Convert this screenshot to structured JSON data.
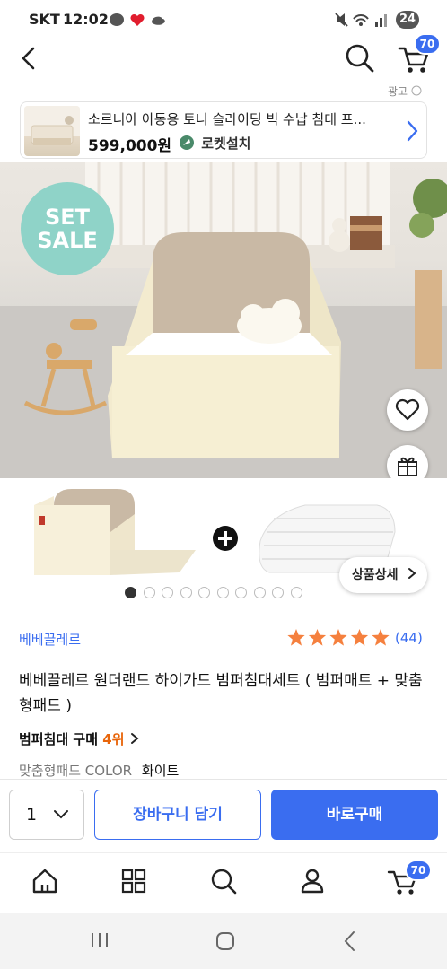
{
  "status_bar": {
    "carrier": "SKT",
    "time": "12:02",
    "battery": "24"
  },
  "header": {
    "cart_count": "70"
  },
  "ad": {
    "label": "광고",
    "title": "소르니아 아동용 토니 슬라이딩 빅 수납 침대 프...",
    "price": "599,000원",
    "delivery": "로켓설치"
  },
  "hero": {
    "badge_line1": "SET",
    "badge_line2": "SALE",
    "detail_button": "상품상세"
  },
  "carousel": {
    "total_dots": 10,
    "active_index": 0
  },
  "product": {
    "brand": "베베끌레르",
    "rating": 5,
    "review_count": "(44)",
    "title": "베베끌레르 원더랜드 하이가드 범퍼침대세트 ( 범퍼매트 + 맞춤형패드 )",
    "rank_prefix": "범퍼침대 구매",
    "rank_value": "4위",
    "option_label": "맞춤형패드 COLOR",
    "option_value": "화이트"
  },
  "purchase": {
    "quantity": "1",
    "add_to_cart": "장바구니 담기",
    "buy_now": "바로구매"
  },
  "bottom_nav": {
    "cart_count": "70"
  },
  "colors": {
    "accent": "#3a6df0",
    "rank": "#e8650a",
    "sale_badge": "#8fd3c8",
    "star": "#f5803e"
  }
}
